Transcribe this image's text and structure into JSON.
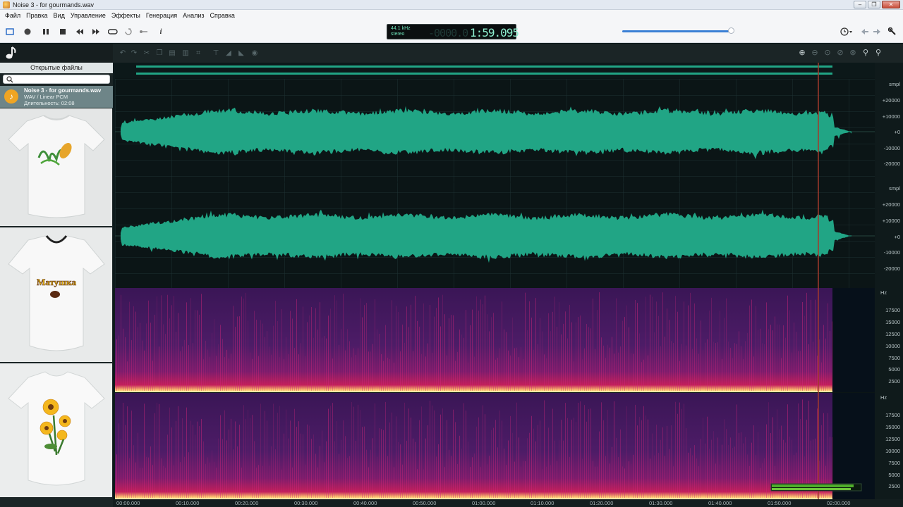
{
  "window": {
    "title": "Noise 3 - for gourmands.wav",
    "controls": [
      "minimize",
      "maximize",
      "close"
    ]
  },
  "menu": [
    "Файл",
    "Правка",
    "Вид",
    "Управление",
    "Эффекты",
    "Генерация",
    "Анализ",
    "Справка"
  ],
  "transport": {
    "buttons": [
      "selection-mode",
      "record",
      "pause",
      "stop",
      "rewind",
      "fast-forward",
      "loop",
      "repeat",
      "skip",
      "info"
    ],
    "lcd": {
      "sample_rate": "44.1 kHz",
      "channels": "stereo",
      "ghost_digits": "-0000.0",
      "time": "1:59.095"
    },
    "volume_level": 0.95
  },
  "left_panel": {
    "title": "Открытые файлы",
    "search_placeholder": "",
    "file": {
      "name": "Noise 3 - for gourmands.wav",
      "format": "WAV / Linear PCM",
      "duration": "Длительность: 02:08"
    },
    "thumbnails": [
      "t-shirt-plant-design",
      "t-shirt-text-design",
      "t-shirt-flower-design"
    ],
    "thumbnail_text": "Матушка"
  },
  "waveform_scale": {
    "unit": "smpl",
    "ticks": [
      "+20000",
      "+10000",
      "+0",
      "-10000",
      "-20000"
    ]
  },
  "spectrogram_scale": {
    "unit": "Hz",
    "ticks": [
      "17500",
      "15000",
      "12500",
      "10000",
      "7500",
      "5000",
      "2500"
    ]
  },
  "timeline": [
    "00:00.000",
    "00:10.000",
    "00:20.000",
    "00:30.000",
    "00:40.000",
    "00:50.000",
    "01:00.000",
    "01:10.000",
    "01:20.000",
    "01:30.000",
    "01:40.000",
    "01:50.000",
    "02:00.000"
  ],
  "colors": {
    "waveform": "#21a585",
    "background": "#0b1516",
    "playhead": "#a23a2c",
    "spectrogram_low": "#23103a",
    "spectrogram_mid": "#b0185c",
    "spectrogram_high": "#ffd47a"
  }
}
